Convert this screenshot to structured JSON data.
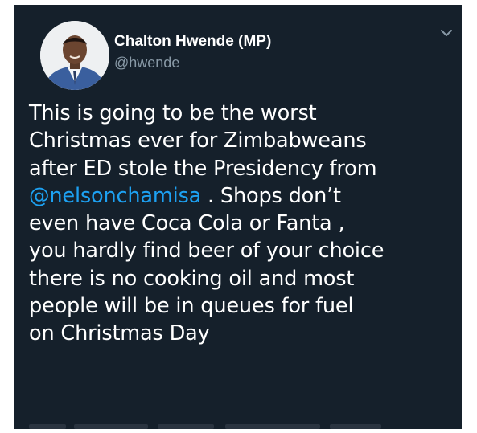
{
  "tweet": {
    "display_name": "Chalton Hwende (MP)",
    "handle": "@hwende",
    "body_lines": [
      {
        "text": "This is going to be the worst"
      },
      {
        "text": "Christmas ever for Zimbabweans"
      },
      {
        "text": "after ED stole the Presidency from"
      },
      {
        "mention": "@nelsonchamisa",
        "text": " . Shops don’t"
      },
      {
        "text": "even have Coca Cola or Fanta ,"
      },
      {
        "text": "you hardly find beer of your choice"
      },
      {
        "text": "there is no cooking oil and most"
      },
      {
        "text": "people will be in queues for fuel"
      },
      {
        "text": "on Christmas Day"
      }
    ],
    "icons": {
      "avatar": "profile-photo",
      "menu": "chevron-down-icon"
    },
    "colors": {
      "background": "#15202b",
      "text": "#ffffff",
      "secondary_text": "#8899a6",
      "link": "#1da1f2"
    }
  }
}
